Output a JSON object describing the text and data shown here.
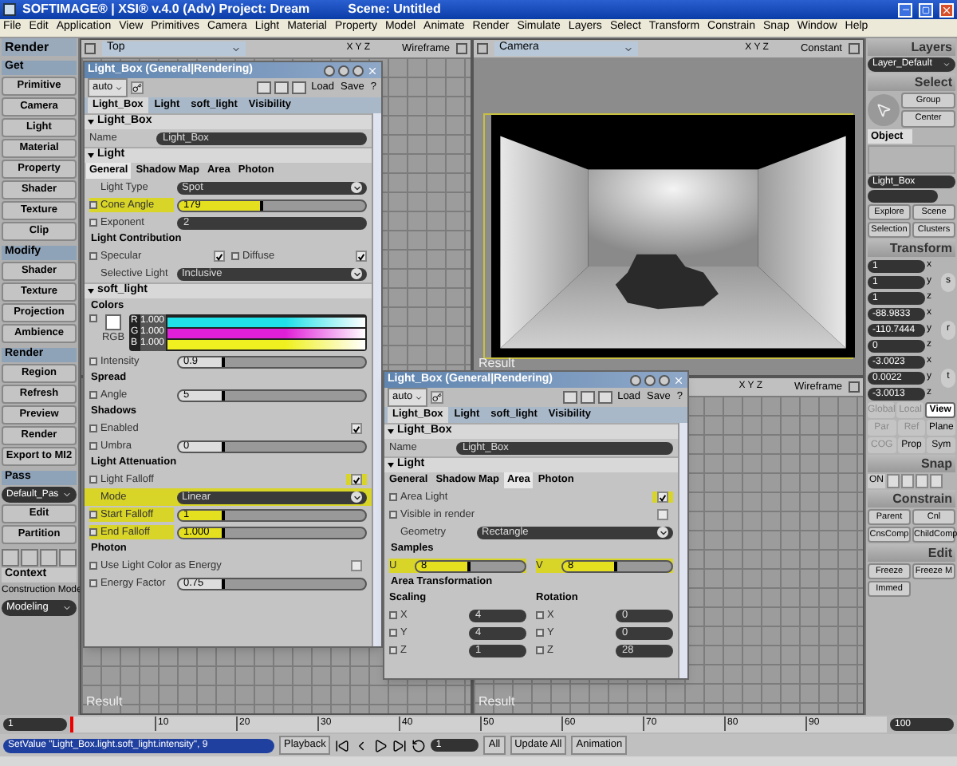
{
  "window": {
    "title": "SOFTIMAGE® | XSI® v.4.0 (Adv) Project: Dream",
    "scene": "Scene: Untitled"
  },
  "menu": [
    "File",
    "Edit",
    "Application",
    "View",
    "Primitives",
    "Camera",
    "Light",
    "Material",
    "Property",
    "Model",
    "Animate",
    "Render",
    "Simulate",
    "Layers",
    "Select",
    "Transform",
    "Constrain",
    "Snap",
    "Window",
    "Help"
  ],
  "left_panel": {
    "title": "Render",
    "sections": [
      {
        "title": "Get",
        "buttons": [
          "Primitive",
          "Camera",
          "Light",
          "Material",
          "Property",
          "Shader",
          "Texture",
          "Clip"
        ]
      },
      {
        "title": "Modify",
        "buttons": [
          "Shader",
          "Texture",
          "Projection",
          "Ambience"
        ]
      },
      {
        "title": "Render",
        "buttons": [
          "Region",
          "Refresh",
          "Preview",
          "Render",
          "Export to MI2"
        ]
      },
      {
        "title": "Pass",
        "dropdown": "Default_Pas",
        "buttons": [
          "Edit",
          "Partition"
        ]
      }
    ],
    "context": {
      "title": "Context",
      "label": "Construction Mode",
      "value": "Modeling"
    }
  },
  "viewports": [
    {
      "kind": "wireframe",
      "title": "Top",
      "axes": "X Y Z",
      "mode": "Wireframe"
    },
    {
      "kind": "render",
      "title": "Camera",
      "axes": "X Y Z",
      "mode": "Constant",
      "label": "Result"
    },
    {
      "kind": "wireframe",
      "label": "Result"
    },
    {
      "kind": "car",
      "axes": "X Y Z",
      "mode": "Wireframe",
      "label": "Result"
    }
  ],
  "panels": [
    {
      "title": "Light_Box (General|Rendering)",
      "preset": "auto",
      "load": "Load",
      "save": "Save",
      "help": "?",
      "tabs": [
        {
          "label": "Light_Box",
          "selected": true
        },
        {
          "label": "Light",
          "selected": false
        },
        {
          "label": "soft_light",
          "selected": false
        },
        {
          "label": "Visibility",
          "selected": false
        }
      ],
      "rows": [
        {
          "kind": "section",
          "label": "Light_Box"
        },
        {
          "kind": "text",
          "label": "Name",
          "value": "Light_Box"
        },
        {
          "kind": "section",
          "label": "Light"
        },
        {
          "kind": "tabs",
          "tabs": [
            {
              "label": "General",
              "selected": true
            },
            {
              "label": "Shadow Map",
              "selected": false
            },
            {
              "label": "Area",
              "selected": false
            },
            {
              "label": "Photon",
              "selected": false
            }
          ]
        },
        {
          "kind": "dropdown",
          "label": "Light Type",
          "value": "Spot",
          "highlighted": false
        },
        {
          "kind": "slider",
          "label": "Cone Angle",
          "value": "179",
          "level": 0.45,
          "highlighted": true
        },
        {
          "kind": "field",
          "label": "Exponent",
          "value": "2"
        },
        {
          "kind": "heading",
          "label": "Light Contribution"
        },
        {
          "kind": "checkpair",
          "items": [
            {
              "label": "Specular",
              "checked": true
            },
            {
              "label": "Diffuse",
              "checked": true
            }
          ]
        },
        {
          "kind": "dropdown",
          "label": "Selective Light",
          "value": "Inclusive",
          "highlighted": false
        },
        {
          "kind": "section",
          "label": "soft_light"
        },
        {
          "kind": "heading",
          "label": "Colors"
        },
        {
          "kind": "colors",
          "label": "RGB",
          "channels": [
            {
              "name": "R",
              "value": "1.000",
              "color": "#20e0e8"
            },
            {
              "name": "G",
              "value": "1.000",
              "color": "#e020d8"
            },
            {
              "name": "B",
              "value": "1.000",
              "color": "#f0f020"
            }
          ]
        },
        {
          "kind": "slider",
          "label": "Intensity",
          "value": "0.9",
          "level": 0.25,
          "highlighted": false
        },
        {
          "kind": "heading",
          "label": "Spread"
        },
        {
          "kind": "slider",
          "label": "Angle",
          "value": "5",
          "level": 0.25,
          "highlighted": false
        },
        {
          "kind": "heading",
          "label": "Shadows"
        },
        {
          "kind": "check",
          "label": "Enabled",
          "checked": true,
          "highlighted": false
        },
        {
          "kind": "slider",
          "label": "Umbra",
          "value": "0",
          "level": 0.25,
          "highlighted": false
        },
        {
          "kind": "heading",
          "label": "Light Attenuation"
        },
        {
          "kind": "check",
          "label": "Light Falloff",
          "checked": true,
          "highlighted": true
        },
        {
          "kind": "dropdown",
          "label": "Mode",
          "value": "Linear",
          "highlighted": true
        },
        {
          "kind": "slider",
          "label": "Start Falloff",
          "value": "1",
          "level": 0.25,
          "highlighted": true
        },
        {
          "kind": "slider",
          "label": "End Falloff",
          "value": "1.000",
          "level": 0.25,
          "highlighted": true
        },
        {
          "kind": "heading",
          "label": "Photon"
        },
        {
          "kind": "check",
          "label": "Use Light Color as Energy",
          "checked": false,
          "highlighted": false
        },
        {
          "kind": "slider",
          "label": "Energy Factor",
          "value": "0.75",
          "level": 0.25,
          "highlighted": false
        }
      ]
    },
    {
      "title": "Light_Box (General|Rendering)",
      "preset": "auto",
      "load": "Load",
      "save": "Save",
      "help": "?",
      "tabs": [
        {
          "label": "Light_Box",
          "selected": true
        },
        {
          "label": "Light",
          "selected": false
        },
        {
          "label": "soft_light",
          "selected": false
        },
        {
          "label": "Visibility",
          "selected": false
        }
      ],
      "rows": [
        {
          "kind": "section",
          "label": "Light_Box"
        },
        {
          "kind": "text",
          "label": "Name",
          "value": "Light_Box"
        },
        {
          "kind": "section",
          "label": "Light"
        },
        {
          "kind": "tabs",
          "tabs": [
            {
              "label": "General",
              "selected": false
            },
            {
              "label": "Shadow Map",
              "selected": false
            },
            {
              "label": "Area",
              "selected": true
            },
            {
              "label": "Photon",
              "selected": false
            }
          ]
        },
        {
          "kind": "check",
          "label": "Area Light",
          "checked": true,
          "highlighted": true
        },
        {
          "kind": "check",
          "label": "Visible in render",
          "checked": false,
          "highlighted": false
        },
        {
          "kind": "dropdown",
          "label": "Geometry",
          "value": "Rectangle",
          "highlighted": false
        },
        {
          "kind": "heading",
          "label": "Samples"
        },
        {
          "kind": "sliderpair",
          "items": [
            {
              "label": "U",
              "value": "8",
              "level": 0.5
            },
            {
              "label": "V",
              "value": "8",
              "level": 0.5
            }
          ]
        },
        {
          "kind": "heading",
          "label": "Area Transformation"
        },
        {
          "kind": "columns",
          "columns": [
            {
              "title": "Scaling",
              "items": [
                {
                  "label": "X",
                  "value": "4"
                },
                {
                  "label": "Y",
                  "value": "4"
                },
                {
                  "label": "Z",
                  "value": "1"
                }
              ]
            },
            {
              "title": "Rotation",
              "items": [
                {
                  "label": "X",
                  "value": "0"
                },
                {
                  "label": "Y",
                  "value": "0"
                },
                {
                  "label": "Z",
                  "value": "28"
                }
              ]
            }
          ]
        }
      ]
    }
  ],
  "right_panel": {
    "layers": {
      "title": "Layers",
      "value": "Layer_Default"
    },
    "select": {
      "title": "Select",
      "buttons": [
        "Group",
        "Center"
      ],
      "tab": "Object",
      "name": "Light_Box",
      "buttons2": [
        "Explore",
        "Scene",
        "Selection",
        "Clusters"
      ]
    },
    "transform": {
      "title": "Transform",
      "groups": [
        {
          "key": "s",
          "values": [
            {
              "value": "1",
              "axis": "x"
            },
            {
              "value": "1",
              "axis": "y"
            },
            {
              "value": "1",
              "axis": "z"
            }
          ]
        },
        {
          "key": "r",
          "values": [
            {
              "value": "-88.9833",
              "axis": "x"
            },
            {
              "value": "-110.7444",
              "axis": "y"
            },
            {
              "value": "0",
              "axis": "z"
            }
          ]
        },
        {
          "key": "t",
          "values": [
            {
              "value": "-3.0023",
              "axis": "x"
            },
            {
              "value": "0.0022",
              "axis": "y"
            },
            {
              "value": "-3.0013",
              "axis": "z"
            }
          ]
        }
      ],
      "modes": [
        [
          {
            "label": "Global",
            "disabled": true,
            "selected": false
          },
          {
            "label": "Local",
            "disabled": true,
            "selected": false
          },
          {
            "label": "View",
            "disabled": false,
            "selected": true
          }
        ],
        [
          {
            "label": "Par",
            "disabled": true,
            "selected": false
          },
          {
            "label": "Ref",
            "disabled": true,
            "selected": false
          },
          {
            "label": "Plane",
            "disabled": false,
            "selected": false
          }
        ],
        [
          {
            "label": "COG",
            "disabled": true,
            "selected": false
          },
          {
            "label": "Prop",
            "disabled": false,
            "selected": false
          },
          {
            "label": "Sym",
            "disabled": false,
            "selected": false
          }
        ]
      ]
    },
    "snap": {
      "title": "Snap",
      "on": "ON"
    },
    "constrain": {
      "title": "Constrain",
      "buttons": [
        "Parent",
        "Cnl",
        "CnsComp",
        "ChildComp"
      ]
    },
    "edit": {
      "title": "Edit",
      "buttons": [
        "Freeze",
        "Freeze M",
        "Immed"
      ]
    }
  },
  "timeline": {
    "start": "1",
    "ticks": [
      "10",
      "20",
      "30",
      "40",
      "50",
      "60",
      "70",
      "80",
      "90"
    ],
    "end": "100"
  },
  "command_bar": {
    "command": "SetValue \"Light_Box.light.soft_light.intensity\", 9",
    "playback": "Playback",
    "frame": "1",
    "all": "All",
    "update_all": "Update All",
    "animation": "Animation"
  }
}
